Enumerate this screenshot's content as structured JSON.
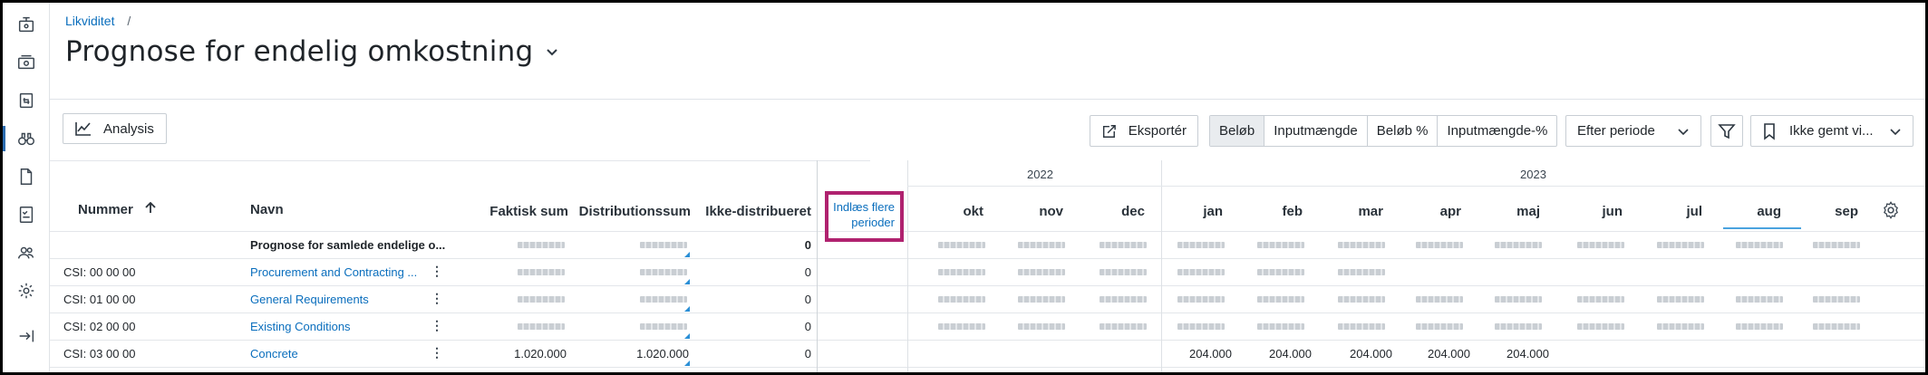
{
  "breadcrumb": {
    "parent": "Likviditet",
    "separator": "/"
  },
  "page_title": "Prognose for endelig omkostning",
  "toolbar": {
    "analysis_label": "Analysis",
    "export_label": "Eksportér",
    "view_modes": [
      "Beløb",
      "Inputmængde",
      "Beløb %",
      "Inputmængde-%"
    ],
    "period_select": "Efter periode",
    "saved_view_select": "Ikke gemt vi..."
  },
  "table": {
    "columns": {
      "number": "Nummer",
      "name": "Navn",
      "actual_sum": "Faktisk sum",
      "distribution_sum": "Distributionssum",
      "not_distributed": "Ikke-distribueret"
    },
    "load_more": {
      "line1": "Indlæs flere",
      "line2": "perioder"
    },
    "years": [
      "2022",
      "2023"
    ],
    "months": [
      "okt",
      "nov",
      "dec",
      "jan",
      "feb",
      "mar",
      "apr",
      "maj",
      "jun",
      "jul",
      "aug",
      "sep"
    ],
    "rows": [
      {
        "number": "",
        "name": "Prognose for samlede endelige o...",
        "not_distributed": "0"
      },
      {
        "number": "CSI: 00 00 00",
        "name": "Procurement and Contracting ...",
        "not_distributed": "0"
      },
      {
        "number": "CSI: 01 00 00",
        "name": "General Requirements",
        "not_distributed": "0"
      },
      {
        "number": "CSI: 02 00 00",
        "name": "Existing Conditions",
        "not_distributed": "0"
      },
      {
        "number": "CSI: 03 00 00",
        "name": "Concrete",
        "actual_sum": "1.020.000",
        "distribution_sum": "1.020.000",
        "not_distributed": "0",
        "months": {
          "jan": "204.000",
          "feb": "204.000",
          "mar": "204.000",
          "apr": "204.000",
          "maj": "204.000"
        }
      }
    ]
  },
  "icons": {
    "rail": [
      "transfer-icon",
      "money-icon",
      "exchange-icon",
      "binoculars-icon",
      "document-icon",
      "checklist-icon",
      "users-icon",
      "gear-icon",
      "collapse-icon"
    ],
    "toolbar": [
      "chart-line-icon",
      "export-icon",
      "filter-icon",
      "bookmark-icon",
      "chevron-down-icon",
      "settings-gear-icon",
      "sort-up-icon"
    ]
  },
  "colors": {
    "link": "#0a6ebd",
    "highlight_border": "#b0226f",
    "active_rail": "#2b6cb0"
  }
}
